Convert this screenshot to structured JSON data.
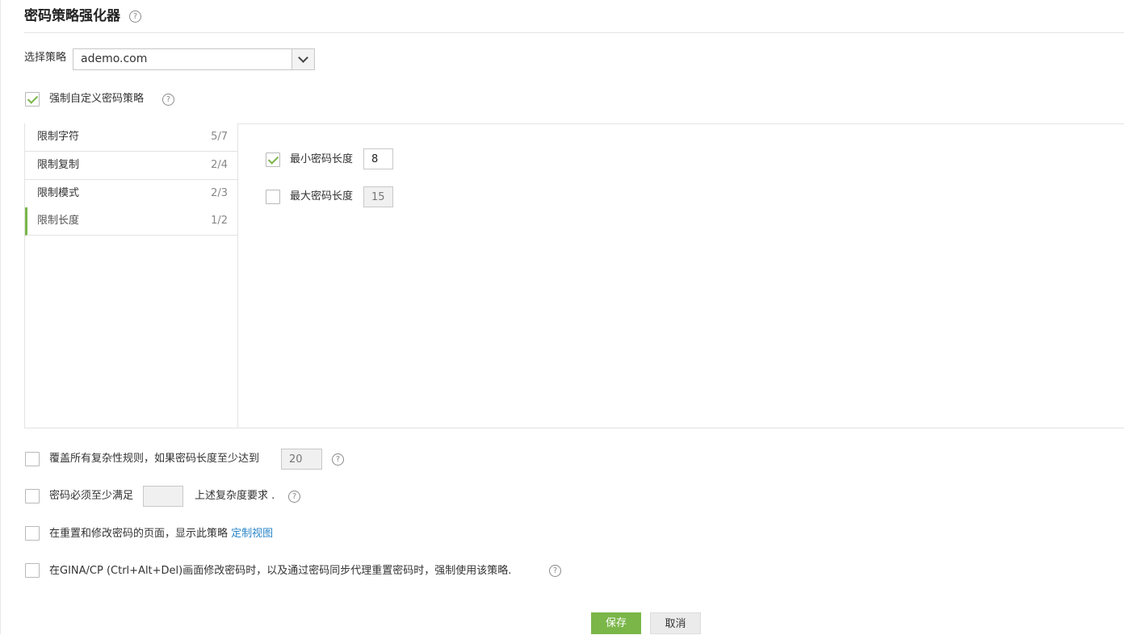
{
  "page": {
    "title": "密码策略强化器",
    "help_glyph": "?"
  },
  "policy_select": {
    "label": "选择策略",
    "value": "ademo.com"
  },
  "enforce_custom": {
    "label": "强制自定义密码策略",
    "checked": true
  },
  "nav": {
    "items": [
      {
        "label": "限制字符",
        "count": "5/7",
        "active": false
      },
      {
        "label": "限制复制",
        "count": "2/4",
        "active": false
      },
      {
        "label": "限制模式",
        "count": "2/3",
        "active": false
      },
      {
        "label": "限制长度",
        "count": "1/2",
        "active": true
      }
    ]
  },
  "length_rules": {
    "min": {
      "label": "最小密码长度",
      "value": "8",
      "checked": true
    },
    "max": {
      "label": "最大密码长度",
      "value": "15",
      "checked": false
    }
  },
  "options": {
    "override": {
      "label": "覆盖所有复杂性规则，如果密码长度至少达到",
      "value": "20",
      "checked": false
    },
    "complexity": {
      "label_before": "密码必须至少满足",
      "value": "",
      "label_after": "上述复杂度要求 .",
      "checked": false
    },
    "display": {
      "label": "在重置和修改密码的页面，显示此策略",
      "link": "定制视图",
      "checked": false
    },
    "gina": {
      "label": "在GINA/CP (Ctrl+Alt+Del)画面修改密码时，以及通过密码同步代理重置密码时，强制使用该策略.",
      "checked": false
    }
  },
  "actions": {
    "save": "保存",
    "cancel": "取消"
  },
  "colors": {
    "accent": "#7ab648",
    "link": "#2a86c8"
  }
}
